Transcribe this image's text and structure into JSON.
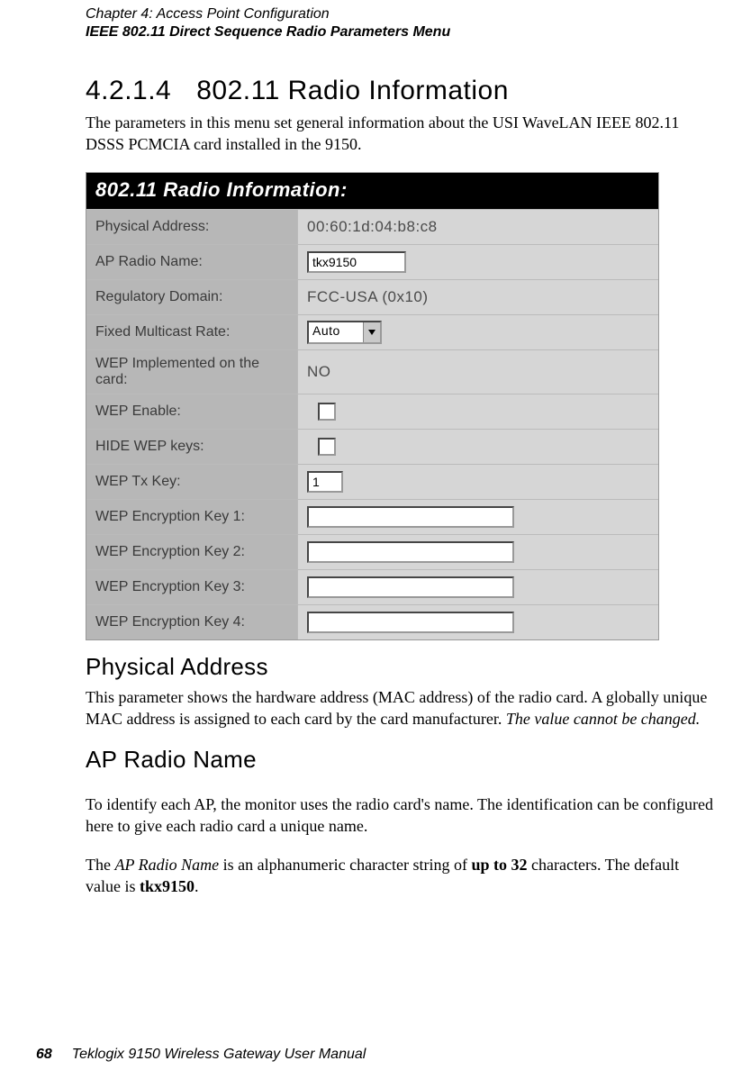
{
  "running_head": {
    "line1_prefix": "Chapter 4:  ",
    "line1_title": "Access Point Configuration",
    "line2": "IEEE 802.11 Direct Sequence Radio Parameters Menu"
  },
  "section": {
    "number": "4.2.1.4",
    "title": "802.11 Radio Information"
  },
  "intro": "The parameters in this menu set general information about the USI WaveLAN IEEE 802.11 DSSS PCMCIA card installed in the 9150.",
  "figure": {
    "title": "802.11 Radio Information:",
    "phys_addr_label": "Physical Address:",
    "phys_addr_value": "00:60:1d:04:b8:c8",
    "ap_name_label": "AP Radio Name:",
    "ap_name_value": "tkx9150",
    "reg_domain_label": "Regulatory Domain:",
    "reg_domain_value": "FCC-USA (0x10)",
    "multicast_label": "Fixed Multicast Rate:",
    "multicast_value": "Auto",
    "wep_impl_label": "WEP Implemented on the card:",
    "wep_impl_value": "NO",
    "wep_enable_label": "WEP Enable:",
    "hide_wep_label": "HIDE WEP keys:",
    "wep_tx_label": "WEP Tx Key:",
    "wep_tx_value": "1",
    "wep_key1_label": "WEP Encryption Key 1:",
    "wep_key2_label": "WEP Encryption Key 2:",
    "wep_key3_label": "WEP Encryption Key 3:",
    "wep_key4_label": "WEP Encryption Key 4:"
  },
  "subsections": {
    "phys_addr_heading": "Physical Address",
    "phys_addr_p1a": "This parameter shows the hardware address (MAC address) of the radio card. A globally unique MAC address is assigned to each card by the card manufacturer. ",
    "phys_addr_p1b": "The value cannot be changed.",
    "ap_name_heading": "AP Radio Name",
    "ap_name_p1": "To identify each AP, the monitor uses the radio card's name. The identification can be configured here to give each radio card a unique name.",
    "ap_name_p2_a": "The ",
    "ap_name_p2_b": "AP Radio Name",
    "ap_name_p2_c": " is an alphanumeric character string of ",
    "ap_name_p2_d": "up to 32",
    "ap_name_p2_e": " characters. The default value is ",
    "ap_name_p2_f": "tkx9150",
    "ap_name_p2_g": "."
  },
  "footer": {
    "page": "68",
    "title": "Teklogix 9150 Wireless Gateway User Manual"
  }
}
